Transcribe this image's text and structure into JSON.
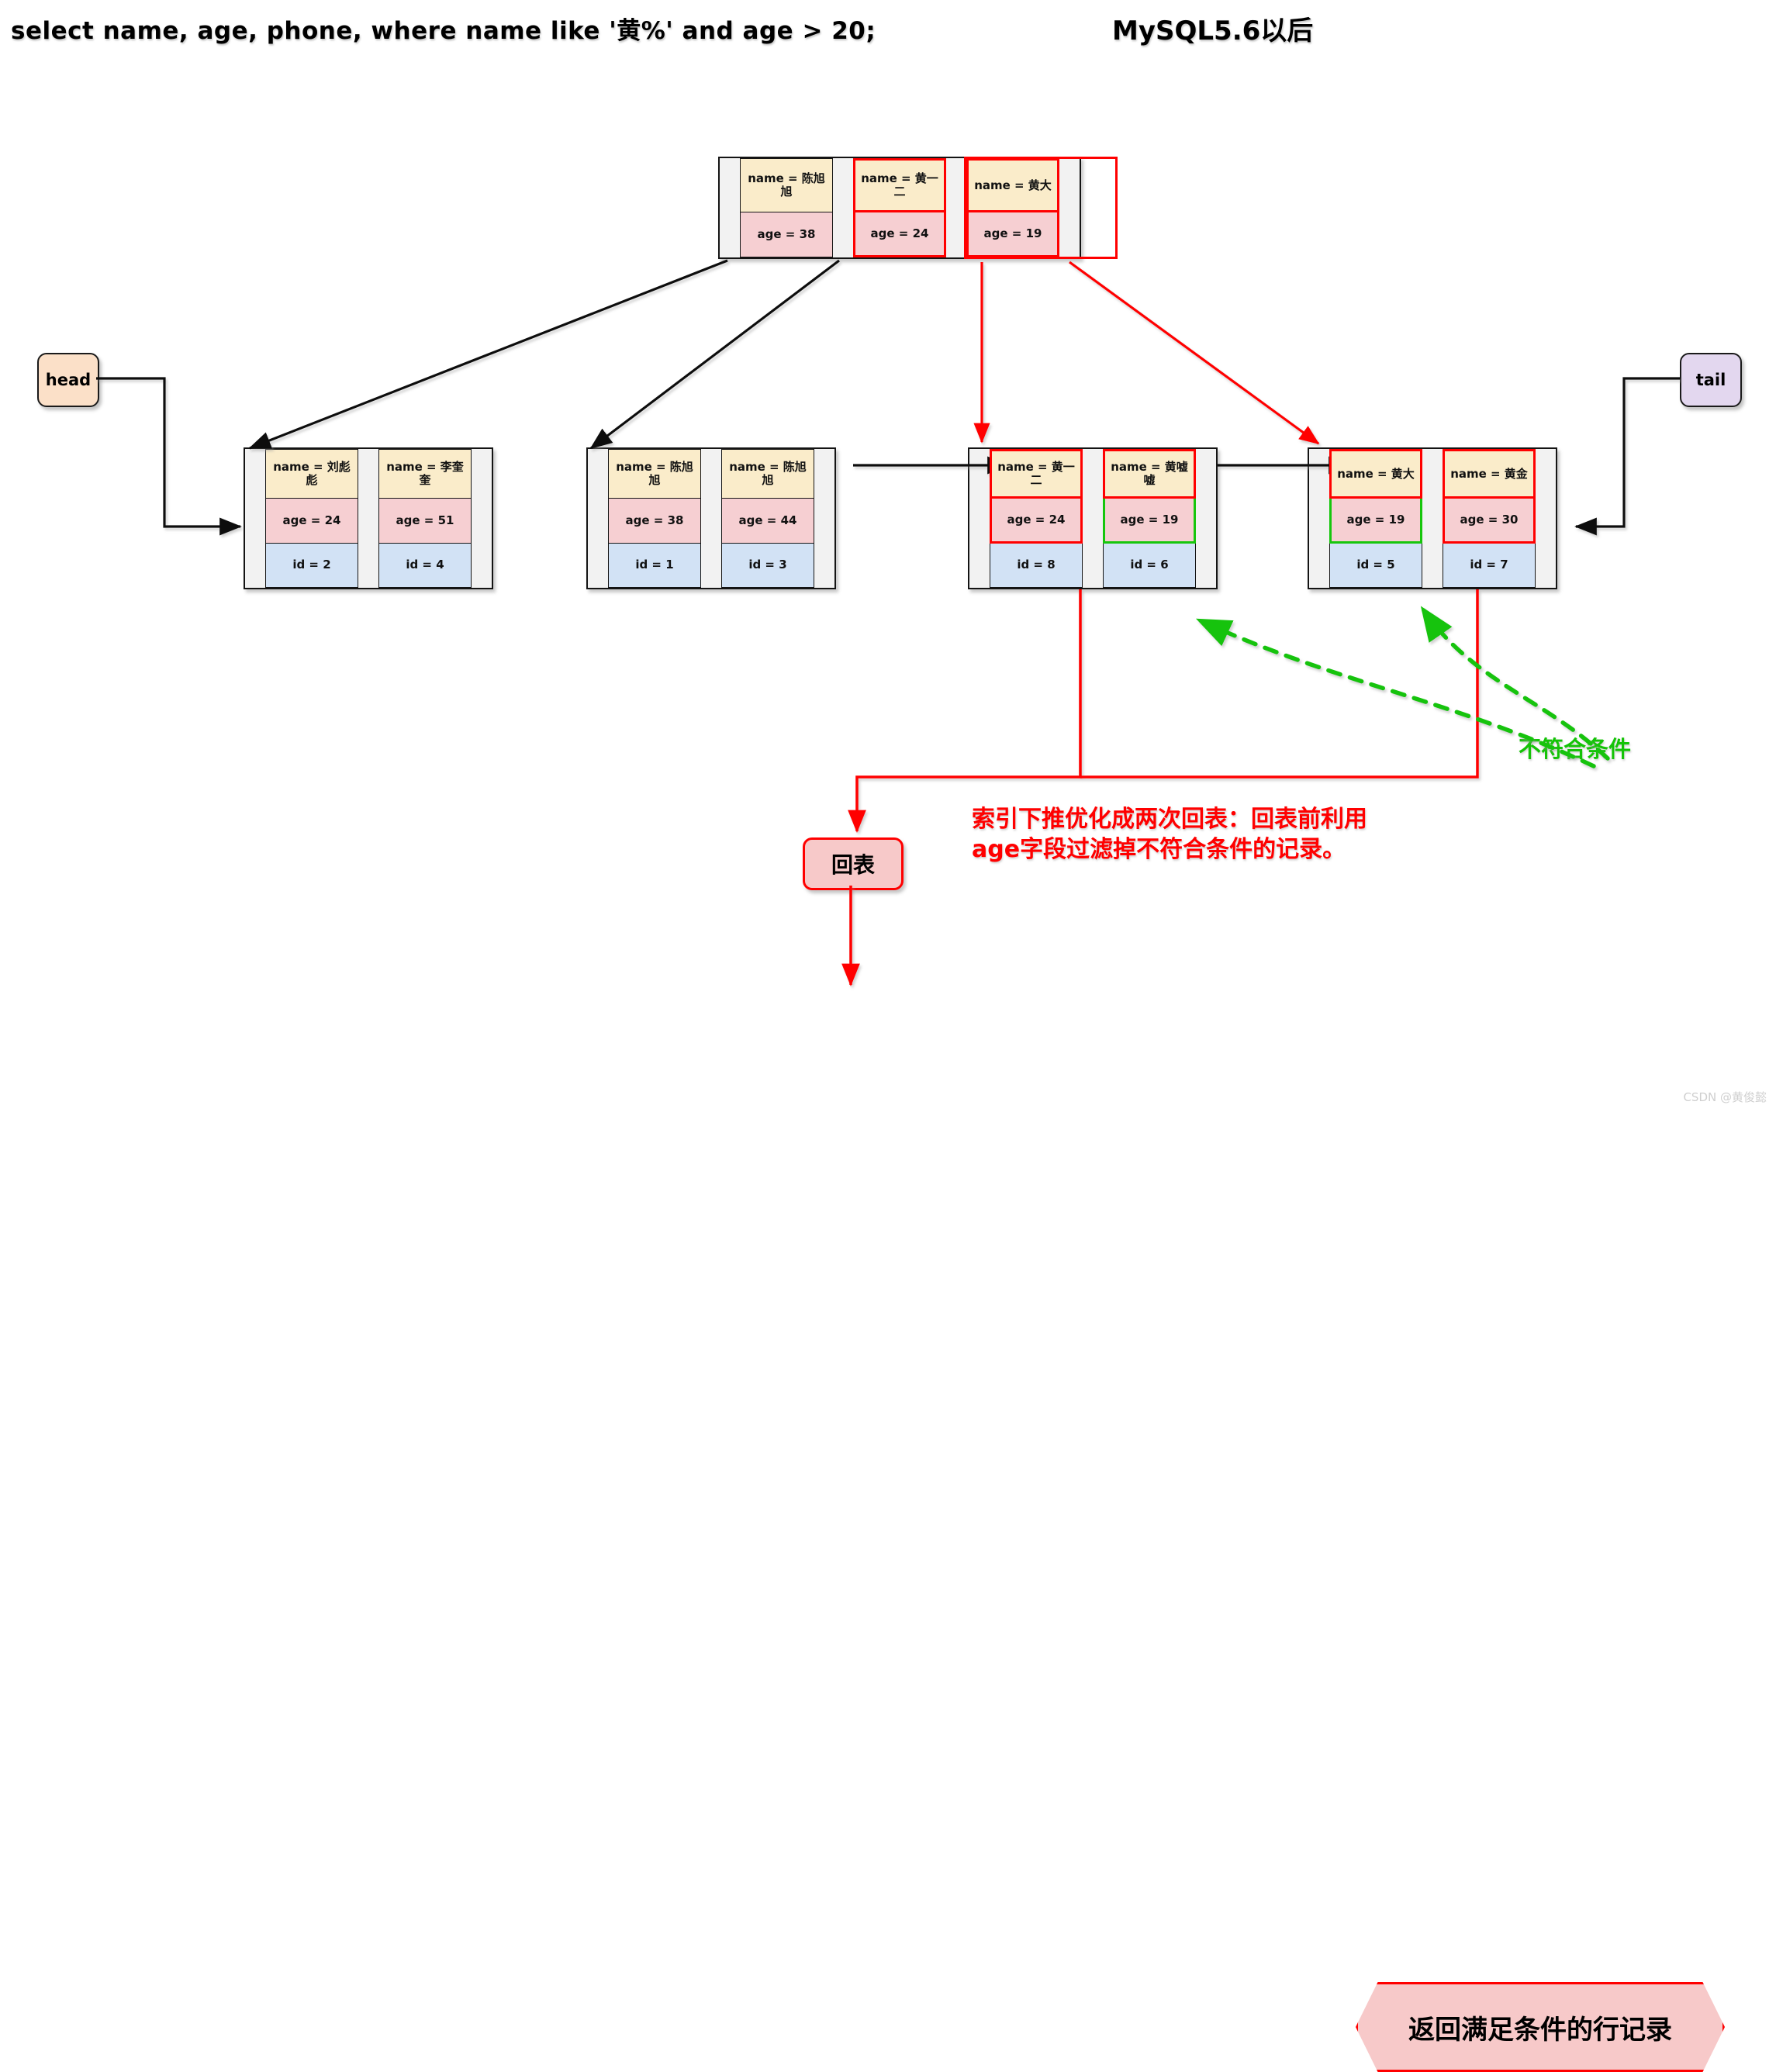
{
  "header": {
    "sql": "select name, age, phone, where name like '黄%' and age > 20;",
    "version": "MySQL5.6以后"
  },
  "endpoints": {
    "head_label": "head",
    "tail_label": "tail"
  },
  "colors": {
    "name_fill": "#faecca",
    "age_fill": "#f6cfd2",
    "id_fill": "#d2e2f5",
    "page_fill": "#f2f2f2",
    "highlight_red": "#ff0000",
    "highlight_green": "#16c60c",
    "head_fill": "#fbe0c8",
    "tail_fill": "#e3d7ef",
    "flow_fill": "#f7c9c9"
  },
  "root_node": {
    "name": "root-node",
    "cells": [
      {
        "name": "name = 陈旭旭",
        "age": "age = 38",
        "name_hl": "none",
        "age_hl": "none"
      },
      {
        "name": "name = 黄一二",
        "age": "age = 24",
        "name_hl": "red",
        "age_hl": "red"
      },
      {
        "name": "name = 黄大",
        "age": "age = 19",
        "name_hl": "red",
        "age_hl": "red"
      }
    ]
  },
  "leaves": [
    {
      "id": "leaf-1",
      "cells": [
        {
          "name": "name = 刘彪彪",
          "age": "age = 24",
          "row_id": "id = 2",
          "name_hl": "none",
          "age_hl": "none"
        },
        {
          "name": "name = 李奎奎",
          "age": "age = 51",
          "row_id": "id = 4",
          "name_hl": "none",
          "age_hl": "none"
        }
      ]
    },
    {
      "id": "leaf-2",
      "cells": [
        {
          "name": "name = 陈旭旭",
          "age": "age = 38",
          "row_id": "id = 1",
          "name_hl": "none",
          "age_hl": "none"
        },
        {
          "name": "name = 陈旭旭",
          "age": "age = 44",
          "row_id": "id = 3",
          "name_hl": "none",
          "age_hl": "none"
        }
      ]
    },
    {
      "id": "leaf-3",
      "cells": [
        {
          "name": "name = 黄一二",
          "age": "age = 24",
          "row_id": "id = 8",
          "name_hl": "red",
          "age_hl": "red"
        },
        {
          "name": "name = 黄嘘嘘",
          "age": "age = 19",
          "row_id": "id = 6",
          "name_hl": "red",
          "age_hl": "green"
        }
      ]
    },
    {
      "id": "leaf-4",
      "cells": [
        {
          "name": "name = 黄大",
          "age": "age = 19",
          "row_id": "id = 5",
          "name_hl": "red",
          "age_hl": "green"
        },
        {
          "name": "name = 黄金",
          "age": "age = 30",
          "row_id": "id = 7",
          "name_hl": "red",
          "age_hl": "red"
        }
      ]
    }
  ],
  "flow": {
    "huibiao": "回表",
    "result": "返回满足条件的行记录"
  },
  "annotations": {
    "red_note_line1": "索引下推优化成两次回表：回表前利用",
    "red_note_line2": "age字段过滤掉不符合条件的记录。",
    "green_note": "不符合条件"
  },
  "watermark": "CSDN @黄俊懿"
}
